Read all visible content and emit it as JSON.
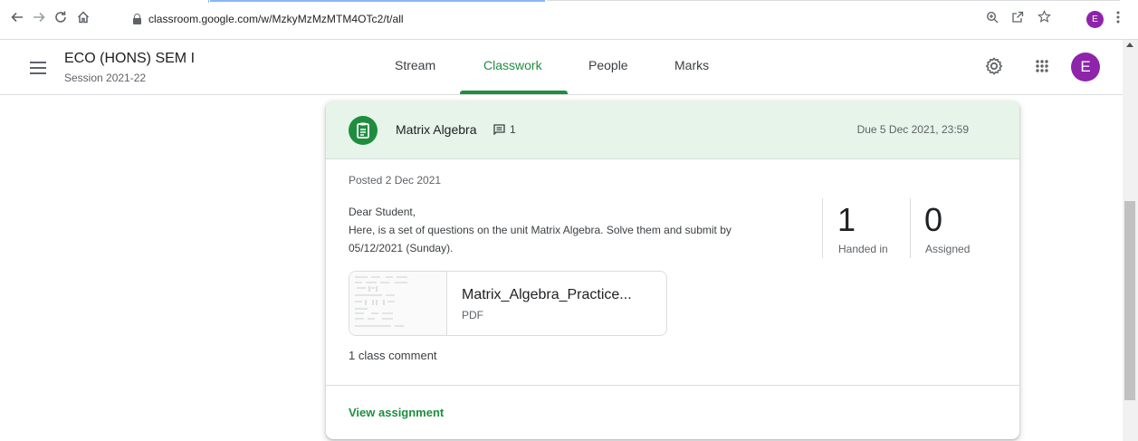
{
  "browser": {
    "url": "classroom.google.com/w/MzkyMzMzMTM4OTc2/t/all",
    "profile_initial": "E"
  },
  "header": {
    "class_title": "ECO (HONS) SEM I",
    "class_subtitle": "Session 2021-22",
    "tabs": [
      {
        "label": "Stream",
        "active": false
      },
      {
        "label": "Classwork",
        "active": true
      },
      {
        "label": "People",
        "active": false
      },
      {
        "label": "Marks",
        "active": false
      }
    ],
    "avatar_initial": "E"
  },
  "assignment": {
    "title": "Matrix Algebra",
    "comment_count": "1",
    "due": "Due 5 Dec 2021, 23:59",
    "posted": "Posted 2 Dec 2021",
    "instructions": [
      "Dear Student,",
      "Here, is a set of questions on the unit Matrix Algebra. Solve them and submit by",
      "05/12/2021 (Sunday)."
    ],
    "stats": [
      {
        "value": "1",
        "label": "Handed in"
      },
      {
        "value": "0",
        "label": "Assigned"
      }
    ],
    "attachment": {
      "name": "Matrix_Algebra_Practice...",
      "type": "PDF"
    },
    "class_comment": "1 class comment",
    "view_link": "View assignment"
  },
  "colors": {
    "accent_green": "#1e8e3e",
    "header_tint": "#e6f4ea",
    "avatar_purple": "#8e24aa"
  },
  "icons": [
    "back-arrow-icon",
    "forward-arrow-icon",
    "reload-icon",
    "home-icon",
    "lock-icon",
    "zoom-icon",
    "share-icon",
    "star-icon",
    "kebab-menu-icon",
    "hamburger-menu-icon",
    "gear-icon",
    "apps-grid-icon",
    "assignment-icon",
    "comment-icon"
  ]
}
